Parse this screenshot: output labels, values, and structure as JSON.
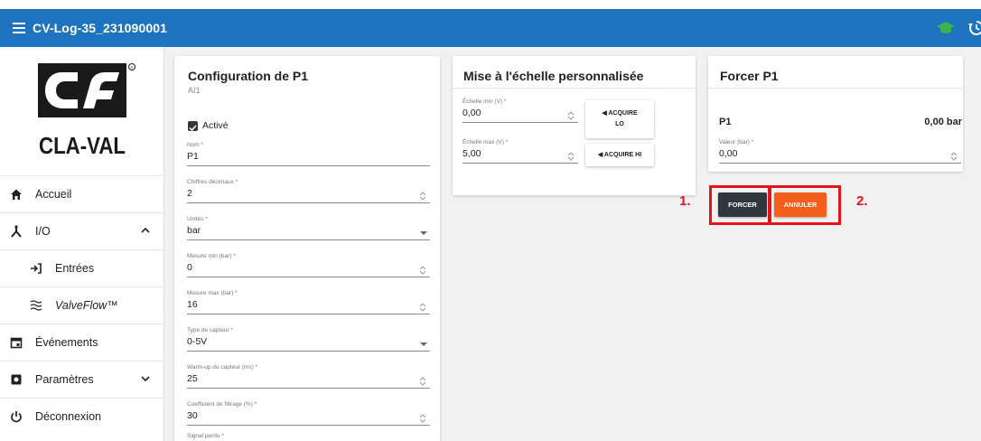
{
  "app": {
    "title": "CV-Log-35_231090001"
  },
  "logo": {
    "text": "CLA-VAL",
    "colors": {
      "ink": "#1a1a1a"
    }
  },
  "sidebar": {
    "items": [
      {
        "label": "Accueil",
        "icon": "home-icon"
      },
      {
        "label": "I/O",
        "icon": "io-icon",
        "expanded": true
      },
      {
        "label": "Entrées",
        "icon": "input-icon"
      },
      {
        "label": "ValveFlow™",
        "icon": "waves-icon"
      },
      {
        "label": "Événements",
        "icon": "calendar-icon"
      },
      {
        "label": "Paramètres",
        "icon": "settings-icon",
        "expanded": false
      },
      {
        "label": "Déconnexion",
        "icon": "power-icon"
      }
    ]
  },
  "config": {
    "title": "Configuration de P1",
    "subtitle": "AI1",
    "enabled_label": "Activé",
    "enabled": true,
    "fields": [
      {
        "label": "Nom *",
        "value": "P1"
      },
      {
        "label": "Chiffres décimaux *",
        "value": "2"
      },
      {
        "label": "Unités *",
        "value": "bar"
      },
      {
        "label": "Mesure min (bar) *",
        "value": "0"
      },
      {
        "label": "Mesure max (bar) *",
        "value": "16"
      },
      {
        "label": "Type de capteur *",
        "value": "0-5V"
      },
      {
        "label": "Warm-up du capteur (ms) *",
        "value": "25"
      },
      {
        "label": "Coefficient de filtrage (%) *",
        "value": "30"
      },
      {
        "label": "Signal perdu *",
        "value": ""
      }
    ]
  },
  "scaling": {
    "title": "Mise à l'échelle personnalisée",
    "min": {
      "label": "Échelle min (V) *",
      "value": "0,00"
    },
    "max": {
      "label": "Échelle max (V) *",
      "value": "5,00"
    },
    "acquire_lo_line1": "◀ ACQUIRE",
    "acquire_lo_line2": "LO",
    "acquire_hi": "◀ ACQUIRE HI"
  },
  "force": {
    "title": "Forcer P1",
    "channel": "P1",
    "reading": "0,00 bar",
    "value_field": {
      "label": "Valeur (bar) *",
      "value": "0,00"
    },
    "force_label": "FORCER",
    "cancel_label": "ANNULER"
  },
  "annotations": {
    "one": "1.",
    "two": "2."
  },
  "colors": {
    "topbar": "#1e73be",
    "accent_orange": "#f4601c",
    "dark_button": "#2f3740",
    "annotation_red": "#e5131a",
    "hat_green": "#3ab54a"
  }
}
